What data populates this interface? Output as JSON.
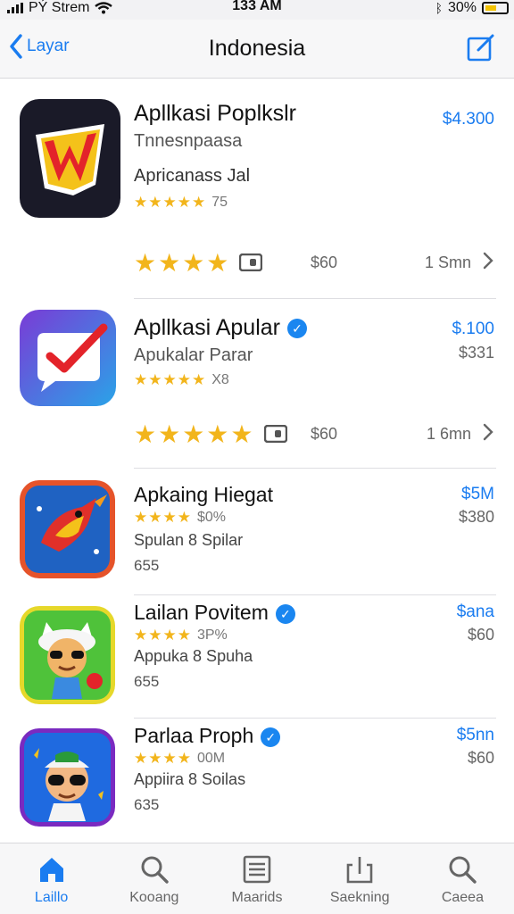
{
  "status": {
    "carrier": "PÝ Strem",
    "time": "133 AM",
    "battery": "30%"
  },
  "nav": {
    "back_label": "Layar",
    "title": "Indonesia"
  },
  "apps": [
    {
      "name": "Apllkasi Poplkslr",
      "subtitle": "Tnnesnpaasa",
      "category": "Apricanass Jal",
      "small_stars": "★★★★★",
      "small_rating": "75",
      "price": "$4.300",
      "big_stars": "★★★★",
      "list_price": "$60",
      "size": "1 Smn"
    },
    {
      "name": "Apllkasi Apular",
      "subtitle": "Apukalar Parar",
      "small_stars": "★★★★★",
      "small_rating": "X8",
      "price": "$.100",
      "price_sub": "$331",
      "big_stars": "★★★★★",
      "list_price": "$60",
      "size": "1 6mn"
    },
    {
      "name": "Apkaing Hiegat",
      "small_stars": "★★★★",
      "small_rating": "$0%",
      "category": "Spulan 8 Spilar",
      "count": "655",
      "price": "$5M",
      "price_sub": "$380"
    },
    {
      "name": "Lailan Povitem",
      "small_stars": "★★★★",
      "small_rating": "3P%",
      "category": "Appuka 8 Spuha",
      "count": "655",
      "price": "$ana",
      "price_sub": "$60"
    },
    {
      "name": "Parlaa Proph",
      "small_stars": "★★★★",
      "small_rating": "00M",
      "category": "Appiira 8 Soilas",
      "count": "635",
      "price": "$5nn",
      "price_sub": "$60"
    }
  ],
  "tabs": [
    {
      "label": "Laillo",
      "icon": "home-icon"
    },
    {
      "label": "Kooang",
      "icon": "search-icon"
    },
    {
      "label": "Maarids",
      "icon": "list-icon"
    },
    {
      "label": "Saekning",
      "icon": "share-icon"
    },
    {
      "label": "Caeea",
      "icon": "search-icon"
    }
  ],
  "colors": {
    "accent": "#1a7cf0",
    "star": "#f2b51c"
  }
}
